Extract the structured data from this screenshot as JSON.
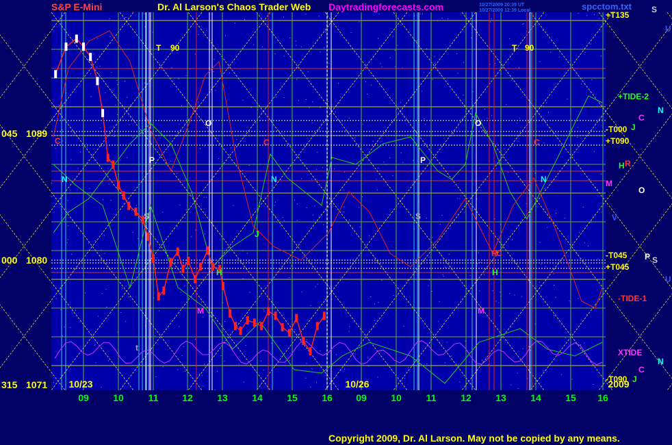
{
  "header": {
    "instrument": "S&P E-Mini",
    "title": "Dr. Al Larson's Chaos Trader Web",
    "site": "Daytradingforecasts.com",
    "stamp_line1": "10/27/2009 20:39 UT",
    "stamp_line2": "10/27/2009 12:39 Local",
    "file": "spcctom.txt"
  },
  "footer": {
    "copyright": "Copyright 2009, Dr. Al Larson.  May not be copied by any means."
  },
  "colors": {
    "background": "#000066",
    "plot": "#0000aa",
    "title": "#ffff00",
    "instrument": "#ff4444",
    "site": "#ff00ff",
    "copyright": "#ffff00",
    "hours": "#00ff00",
    "price_labels": "#ffff00",
    "tide2": "#22cc22",
    "tide1": "#dd2222",
    "xtide": "#cc33ff",
    "price": "#ff2222"
  },
  "chart_data": {
    "type": "line",
    "ylabels": [
      {
        "angle": "045",
        "price": "1089"
      },
      {
        "angle": "000",
        "price": "1080"
      },
      {
        "angle": "315",
        "price": "1071"
      }
    ],
    "ylim": [
      1069.3,
      1102.3
    ],
    "x_hours": [
      "09",
      "10",
      "11",
      "12",
      "13",
      "14",
      "15",
      "16",
      "09",
      "10",
      "11",
      "12",
      "13",
      "14",
      "15",
      "16"
    ],
    "dates": [
      "10/23",
      "10/26"
    ],
    "year": "2009",
    "right_labels": [
      {
        "text": "+T135",
        "color": "#ffff00"
      },
      {
        "text": "+TIDE-2",
        "color": "#22ff22"
      },
      {
        "text": "-T000",
        "color": "#ffff00"
      },
      {
        "text": "+T090",
        "color": "#ffff00"
      },
      {
        "text": "-T045",
        "color": "#ffff00"
      },
      {
        "text": "+T045",
        "color": "#ffff00"
      },
      {
        "text": "-TIDE-1",
        "color": "#ff3333"
      },
      {
        "text": "XTIDE",
        "color": "#ff33ff"
      },
      {
        "text": "-T090",
        "color": "#ffff00"
      }
    ],
    "planet_labels": [
      {
        "text": "S",
        "color": "#cccccc"
      },
      {
        "text": "U",
        "color": "#3355ff"
      },
      {
        "text": "C",
        "color": "#ff33ff"
      },
      {
        "text": "N",
        "color": "#00ffff"
      },
      {
        "text": "J",
        "color": "#22ff22"
      },
      {
        "text": "R",
        "color": "#ff3333"
      },
      {
        "text": "H",
        "color": "#22ff22"
      },
      {
        "text": "M",
        "color": "#ff33ff"
      },
      {
        "text": "O",
        "color": "#ffffff"
      },
      {
        "text": "V",
        "color": "#3355ff"
      },
      {
        "text": "P",
        "color": "#ffffff"
      },
      {
        "text": "S",
        "color": "#cccccc"
      },
      {
        "text": "U",
        "color": "#3355ff"
      },
      {
        "text": "N",
        "color": "#00ffff"
      },
      {
        "text": "C",
        "color": "#ff33ff"
      },
      {
        "text": "J",
        "color": "#22ff22"
      }
    ],
    "in_chart_labels": [
      {
        "text": "T",
        "color": "#ffff00"
      },
      {
        "text": "90",
        "color": "#ffff00"
      },
      {
        "text": "T",
        "color": "#ffff00"
      },
      {
        "text": "90",
        "color": "#ffff00"
      },
      {
        "text": "O",
        "color": "#ffffff"
      },
      {
        "text": "O",
        "color": "#ffffff"
      },
      {
        "text": "C",
        "color": "#ff3333"
      },
      {
        "text": "C",
        "color": "#ff3333"
      },
      {
        "text": "C",
        "color": "#ff3333"
      },
      {
        "text": "C",
        "color": "#ff3333"
      },
      {
        "text": "P",
        "color": "#ffffff"
      },
      {
        "text": "P",
        "color": "#ffffff"
      },
      {
        "text": "N",
        "color": "#00ffff"
      },
      {
        "text": "N",
        "color": "#00ffff"
      },
      {
        "text": "N",
        "color": "#00ffff"
      },
      {
        "text": "S",
        "color": "#aaaaaa"
      },
      {
        "text": "S",
        "color": "#aaaaaa"
      },
      {
        "text": "J",
        "color": "#22ff22"
      },
      {
        "text": "H",
        "color": "#22ff22"
      },
      {
        "text": "H",
        "color": "#22ff22"
      },
      {
        "text": "M",
        "color": "#ff33ff"
      },
      {
        "text": "M",
        "color": "#ff33ff"
      },
      {
        "text": "R",
        "color": "#ff3333"
      },
      {
        "text": "t",
        "color": "#aaaaaa"
      },
      {
        "text": "t",
        "color": "#aaaaaa"
      }
    ],
    "price_series": {
      "name": "",
      "hours": [
        8.2,
        8.5,
        8.8,
        9.0,
        9.2,
        9.4,
        9.55,
        9.7,
        9.85,
        10.0,
        10.15,
        10.3,
        10.5,
        10.7,
        10.85,
        11.0,
        11.15,
        11.3,
        11.5,
        11.7,
        11.85,
        12.0,
        12.2,
        12.35,
        12.55,
        12.7,
        12.9,
        13.0,
        13.2,
        13.35,
        13.5,
        13.7,
        13.9,
        14.1,
        14.3,
        14.5,
        14.7,
        14.9,
        15.1,
        15.3,
        15.5,
        15.7,
        15.9
      ],
      "values": [
        1096.9,
        1099.3,
        1100.0,
        1099.3,
        1098.4,
        1096.3,
        1093.5,
        1089.6,
        1089.0,
        1087.2,
        1086.3,
        1085.4,
        1084.9,
        1084.2,
        1082.7,
        1080.8,
        1077.5,
        1078.0,
        1080.5,
        1081.4,
        1079.9,
        1080.6,
        1079.0,
        1080.1,
        1081.5,
        1080.1,
        1079.9,
        1078.4,
        1076.0,
        1074.9,
        1074.5,
        1075.4,
        1075.2,
        1074.9,
        1076.2,
        1075.8,
        1074.8,
        1074.3,
        1075.6,
        1073.6,
        1072.7,
        1074.9,
        1075.8
      ]
    },
    "tide_series": [
      {
        "name": "TIDE-2",
        "color": "#22cc22"
      },
      {
        "name": "TIDE-1",
        "color": "#dd2222"
      },
      {
        "name": "XTIDE",
        "color": "#cc33ff"
      }
    ],
    "grid": true
  }
}
